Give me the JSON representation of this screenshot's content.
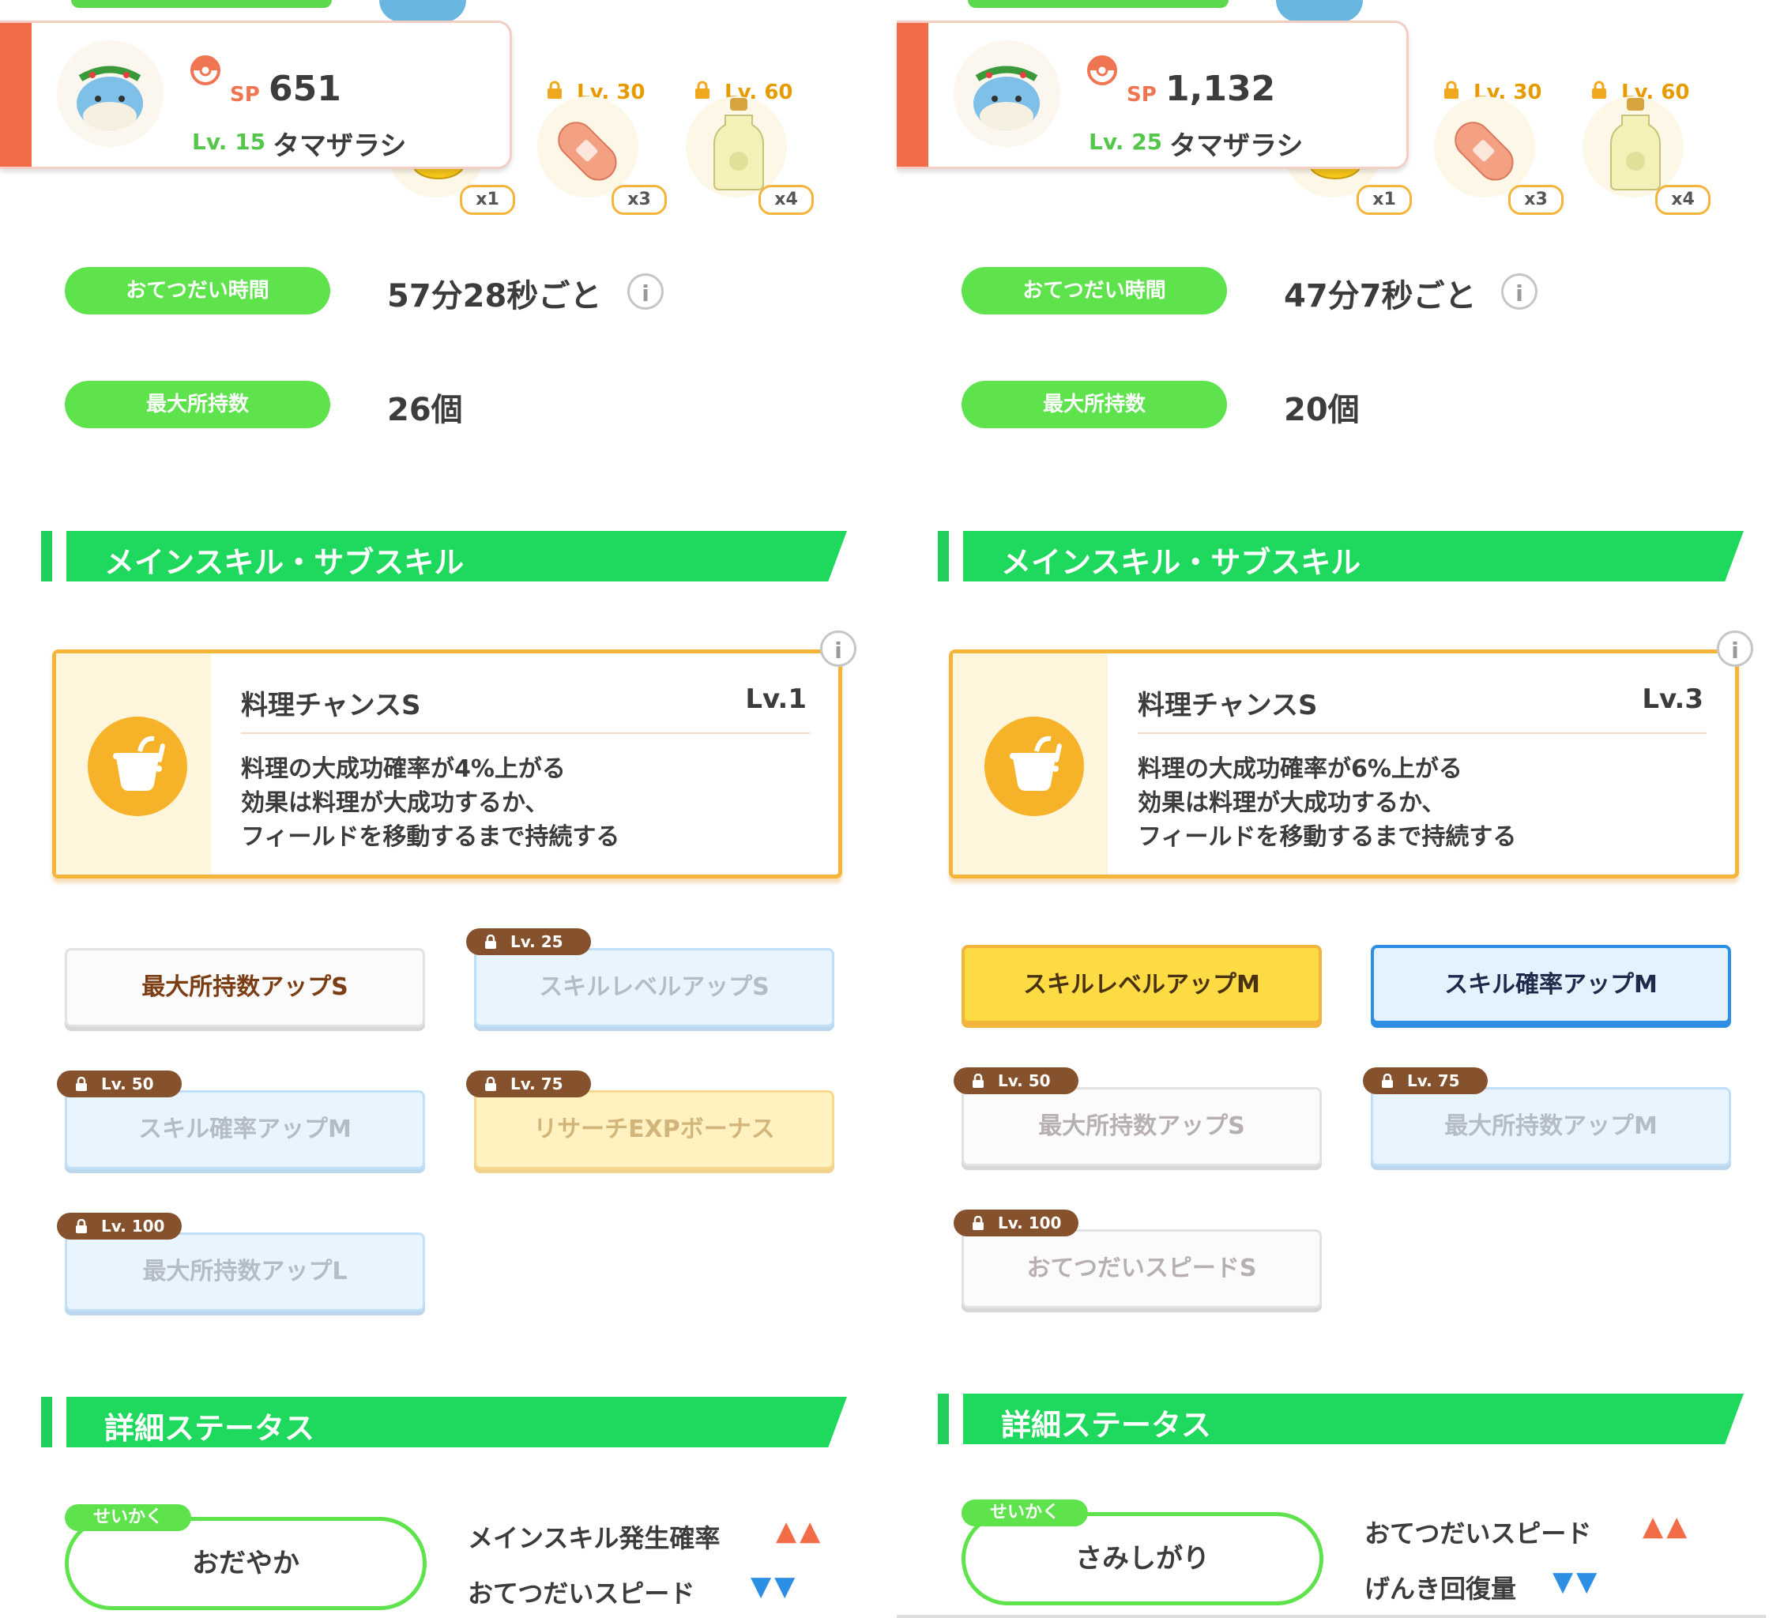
{
  "colors": {
    "accent_green": "#5ee34c",
    "accent_orange": "#f26c47",
    "skill_gold": "#f5b43a",
    "up": "#f26c47",
    "down": "#2d8fe3"
  },
  "left": {
    "header": {
      "sp_label": "SP",
      "sp_value": "651",
      "level": "Lv. 15",
      "name": "タマザラシ"
    },
    "ingredients": [
      {
        "lock_level": "",
        "qty": "x1",
        "icon": "honey-jar-icon"
      },
      {
        "lock_level": "Lv. 30",
        "qty": "x3",
        "icon": "sausage-icon"
      },
      {
        "lock_level": "Lv. 60",
        "qty": "x4",
        "icon": "oil-bottle-icon"
      }
    ],
    "help_time": {
      "label": "おてつだい時間",
      "value": "57分28秒ごと",
      "info": "i"
    },
    "max_carry": {
      "label": "最大所持数",
      "value": "26個"
    },
    "skill_section": {
      "title": "メインスキル・サブスキル"
    },
    "main_skill": {
      "name": "料理チャンスS",
      "level": "Lv.1",
      "desc": [
        "料理の大成功確率が4%上がる",
        "効果は料理が大成功するか、",
        "フィールドを移動するまで持続する"
      ],
      "info": "i"
    },
    "subskills": [
      {
        "name": "最大所持数アップS",
        "lock": ""
      },
      {
        "name": "スキルレベルアップS",
        "lock": "Lv. 25"
      },
      {
        "name": "スキル確率アップM",
        "lock": "Lv. 50"
      },
      {
        "name": "リサーチEXPボーナス",
        "lock": "Lv. 75"
      },
      {
        "name": "最大所持数アップL",
        "lock": "Lv. 100"
      }
    ],
    "detail_section": {
      "title": "詳細ステータス"
    },
    "nature": {
      "tag": "せいかく",
      "name": "おだやか",
      "up_stat": "メインスキル発生確率",
      "up_arrows": "▲▲",
      "down_stat": "おてつだいスピード",
      "down_arrows": "▼▼"
    }
  },
  "right": {
    "header": {
      "sp_label": "SP",
      "sp_value": "1,132",
      "level": "Lv. 25",
      "name": "タマザラシ"
    },
    "ingredients": [
      {
        "lock_level": "",
        "qty": "x1",
        "icon": "honey-jar-icon"
      },
      {
        "lock_level": "Lv. 30",
        "qty": "x3",
        "icon": "sausage-icon"
      },
      {
        "lock_level": "Lv. 60",
        "qty": "x4",
        "icon": "oil-bottle-icon"
      }
    ],
    "help_time": {
      "label": "おてつだい時間",
      "value": "47分7秒ごと",
      "info": "i"
    },
    "max_carry": {
      "label": "最大所持数",
      "value": "20個"
    },
    "skill_section": {
      "title": "メインスキル・サブスキル"
    },
    "main_skill": {
      "name": "料理チャンスS",
      "level": "Lv.3",
      "desc": [
        "料理の大成功確率が6%上がる",
        "効果は料理が大成功するか、",
        "フィールドを移動するまで持続する"
      ],
      "info": "i"
    },
    "subskills": [
      {
        "name": "スキルレベルアップM",
        "lock": ""
      },
      {
        "name": "スキル確率アップM",
        "lock": ""
      },
      {
        "name": "最大所持数アップS",
        "lock": "Lv. 50"
      },
      {
        "name": "最大所持数アップM",
        "lock": "Lv. 75"
      },
      {
        "name": "おてつだいスピードS",
        "lock": "Lv. 100"
      }
    ],
    "detail_section": {
      "title": "詳細ステータス"
    },
    "nature": {
      "tag": "せいかく",
      "name": "さみしがり",
      "up_stat": "おてつだいスピード",
      "up_arrows": "▲▲",
      "down_stat": "げんき回復量",
      "down_arrows": "▼▼"
    }
  }
}
